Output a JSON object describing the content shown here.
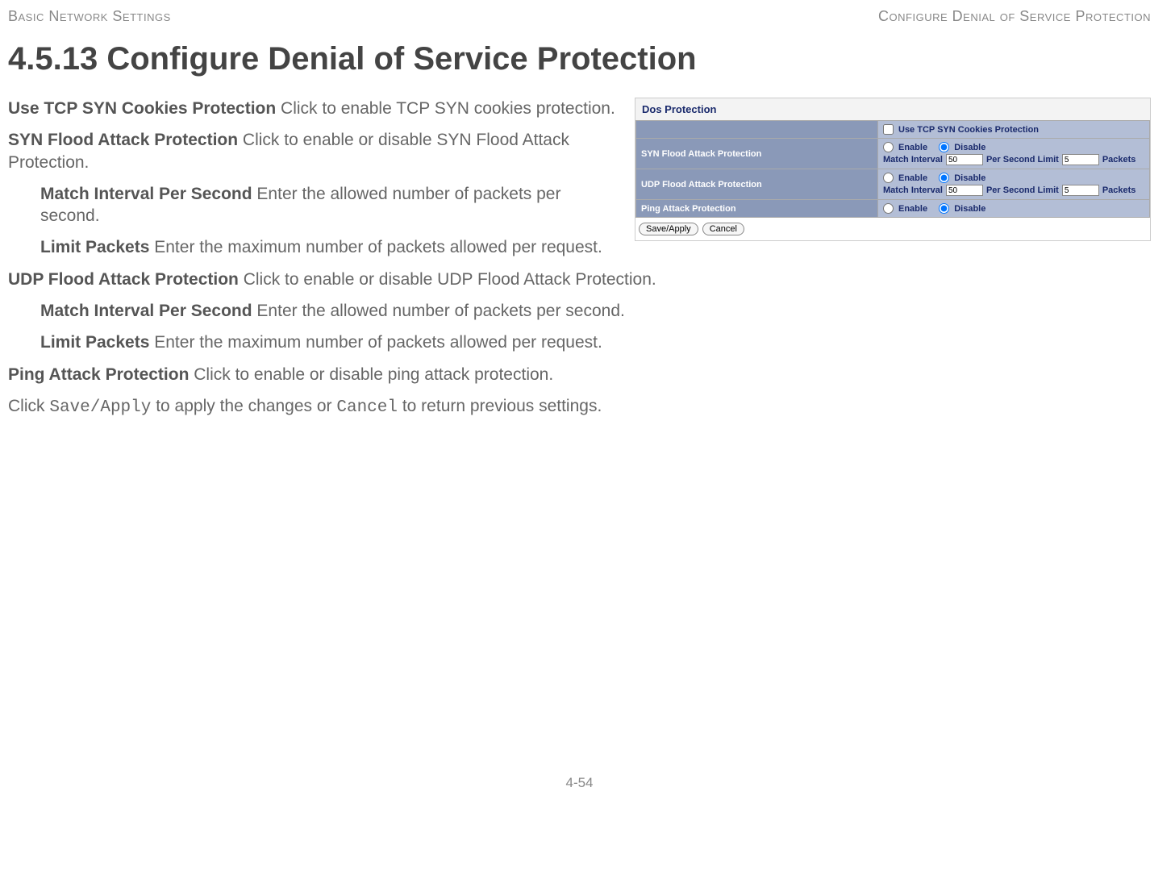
{
  "header": {
    "left": "Basic Network Settings",
    "right": "Configure Denial of Service Protection"
  },
  "title": "4.5.13 Configure Denial of Service Protection",
  "screenshot": {
    "panel_title": "Dos Protection",
    "tcp_cookies_label": "Use TCP SYN Cookies Protection",
    "rows": {
      "syn": {
        "label": "SYN Flood Attack Protection",
        "enable": "Enable",
        "disable": "Disable",
        "match_interval_label": "Match Interval",
        "match_interval_value": "50",
        "per_second_limit_label": "Per Second Limit",
        "per_second_limit_value": "5",
        "packets": "Packets"
      },
      "udp": {
        "label": "UDP Flood Attack Protection",
        "enable": "Enable",
        "disable": "Disable",
        "match_interval_label": "Match Interval",
        "match_interval_value": "50",
        "per_second_limit_label": "Per Second Limit",
        "per_second_limit_value": "5",
        "packets": "Packets"
      },
      "ping": {
        "label": "Ping Attack Protection",
        "enable": "Enable",
        "disable": "Disable"
      }
    },
    "buttons": {
      "save": "Save/Apply",
      "cancel": "Cancel"
    }
  },
  "paragraphs": {
    "p1_term": "Use TCP SYN Cookies Protection",
    "p1_text": "  Click to enable TCP SYN cookies protection.",
    "p2_term": "SYN Flood Attack Protection",
    "p2_text": "  Click to enable or disable SYN Flood Attack Protection.",
    "p3_term": "Match Interval Per Second",
    "p3_text": "   Enter the allowed number of packets per second.",
    "p4_term": "Limit Packets",
    "p4_text": "  Enter the maximum number of packets allowed per request.",
    "p5_term": "UDP Flood Attack Protection",
    "p5_text": "  Click to enable or disable UDP Flood Attack Protection.",
    "p6_term": "Match Interval Per Second",
    "p6_text": "   Enter the allowed number of packets per second.",
    "p7_term": "Limit Packets",
    "p7_text": "  Enter the maximum number of packets allowed per request.",
    "p8_term": "Ping Attack Protection",
    "p8_text": "  Click to enable or disable ping attack protection.",
    "p9_pre": "Click ",
    "p9_code1": "Save/Apply",
    "p9_mid": " to apply the changes or ",
    "p9_code2": "Cancel",
    "p9_post": " to return previous settings."
  },
  "footer": "4-54"
}
